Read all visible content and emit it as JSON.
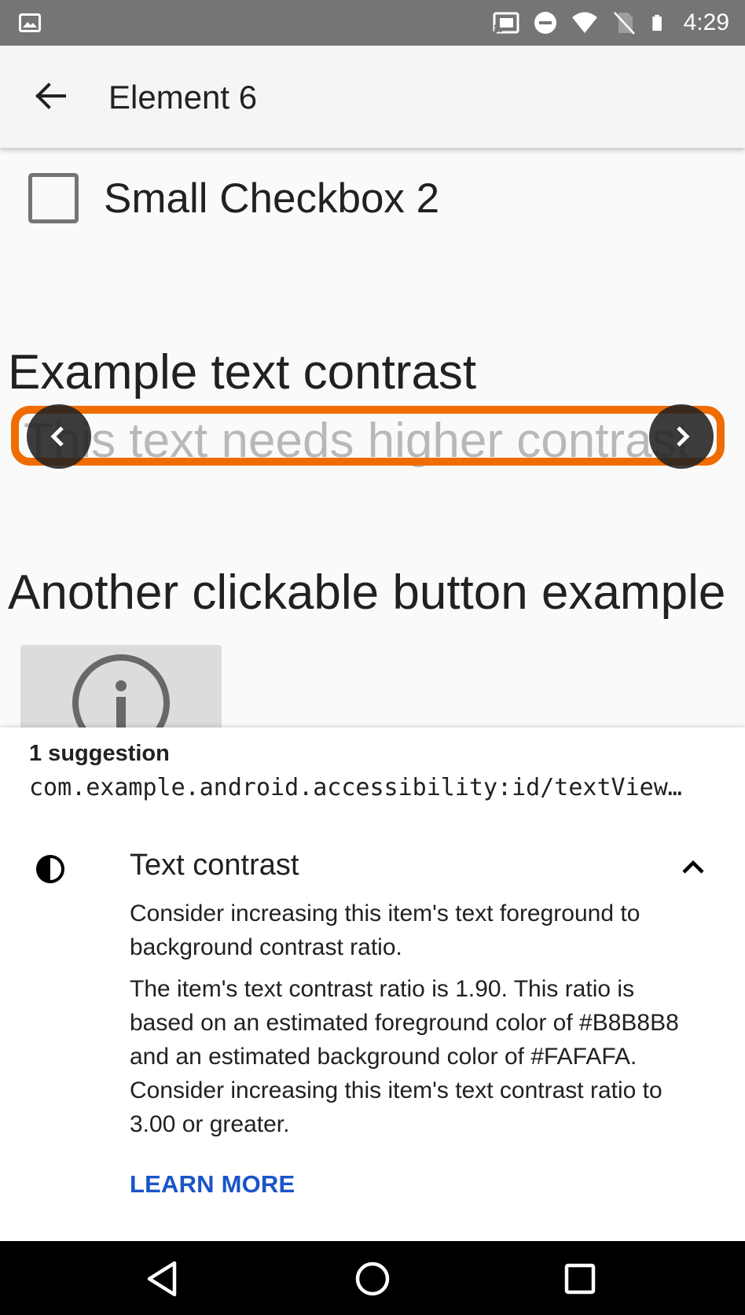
{
  "status_bar": {
    "time": "4:29",
    "icons": [
      "gallery-icon",
      "cast-icon",
      "do-not-disturb-icon",
      "wifi-icon",
      "no-sim-icon",
      "battery-icon"
    ]
  },
  "app_bar": {
    "title": "Element 6",
    "back_icon": "arrow-back-icon"
  },
  "content": {
    "checkbox_label": "Small Checkbox 2",
    "checkbox_checked": false,
    "contrast_heading": "Example text contrast",
    "low_contrast_text": "This text needs higher contrast",
    "button_heading": "Another clickable button example",
    "info_button_icon": "info-icon"
  },
  "overlay": {
    "highlight_color": "#EF6C00",
    "prev_icon": "chevron-left-icon",
    "next_icon": "chevron-right-icon"
  },
  "sheet": {
    "suggestion_count": "1 suggestion",
    "element_id": "com.example.android.accessibility:id/textView…",
    "check_title": "Text contrast",
    "check_icon": "contrast-icon",
    "collapse_icon": "chevron-up-icon",
    "description_short": "Consider increasing this item's text foreground to background contrast ratio.",
    "description_long": "The item's text contrast ratio is 1.90. This ratio is based on an estimated foreground color of #B8B8B8 and an estimated background color of #FAFAFA. Consider increasing this item's text contrast ratio to 3.00 or greater.",
    "learn_more": "LEARN MORE"
  },
  "colors": {
    "foreground_estimate": "#B8B8B8",
    "background_estimate": "#FAFAFA",
    "link": "#1A54C7"
  },
  "nav_bar": {
    "icons": [
      "nav-back-icon",
      "nav-home-icon",
      "nav-recents-icon"
    ]
  }
}
